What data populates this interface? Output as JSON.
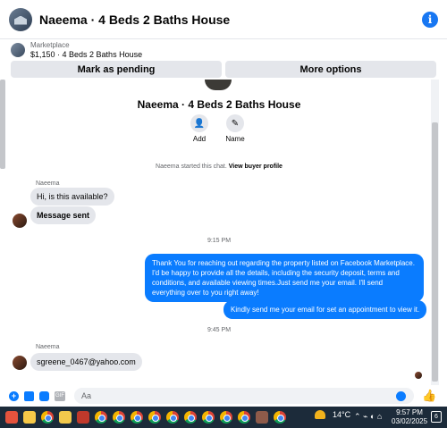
{
  "header": {
    "title": "Naeema · 4 Beds 2 Baths House",
    "info_icon": "i"
  },
  "listing": {
    "category": "Marketplace",
    "name": "$1,150 · 4 Beds 2 Baths House"
  },
  "actions": {
    "pending_label": "Mark as pending",
    "more_label": "More options"
  },
  "profile": {
    "name": "Naeema · 4 Beds 2 Baths House",
    "add_label": "Add",
    "name_label": "Name",
    "add_icon": "👤",
    "edit_icon": "✎"
  },
  "started": {
    "text": "Naeema started this chat. ",
    "link": "View buyer profile"
  },
  "messages": {
    "sender1": "Naeema",
    "in1": "Hi, is this available?",
    "in2": "Message sent",
    "time1": "9:15 PM",
    "out1": "Thank You for reaching out regarding the property listed on Facebook Marketplace. I'd be happy to provide all the details, including the security deposit, terms and conditions, and available viewing times.Just send me your email. I'll send everything over to you right away!",
    "out2": "Kindly send me your email for set an appointment to view it.",
    "time2": "9:45 PM",
    "sender2": "Naeema",
    "in3": "sgreene_0467@yahoo.com"
  },
  "composer": {
    "placeholder": "Aa",
    "gif_label": "GIF",
    "like_icon": "👍"
  },
  "taskbar": {
    "temperature": "14°C",
    "time": "9:57 PM",
    "date": "03/02/2025",
    "notifications": "6",
    "tray": "⌃ ⌁ ◐ ⌂"
  },
  "colors": {
    "accent": "#0a7cff",
    "bubble_in": "#e4e6eb",
    "taskbar": "#1c2b3a"
  }
}
